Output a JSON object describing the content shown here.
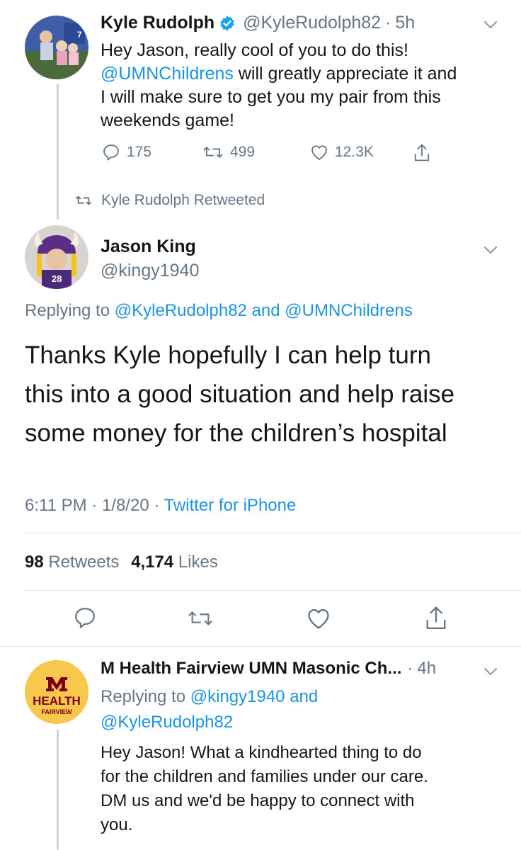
{
  "colors": {
    "accent": "#1b95e0",
    "muted": "#657786",
    "text": "#14171a",
    "divider": "#e1e8ed",
    "verified": "#1da1f2"
  },
  "tweet1": {
    "name": "Kyle Rudolph",
    "handle": "@KyleRudolph82",
    "dot": "·",
    "time": "5h",
    "text_line1": "Hey Jason, really cool of you to do this!",
    "mention": "@UMNChildrens",
    "text_line2_rest": " will greatly appreciate it and",
    "text_line3": "I will make sure to get you my pair from this",
    "text_line4": "weekends game!",
    "replies": "175",
    "retweets": "499",
    "likes": "12.3K",
    "avatar_badge": "7"
  },
  "retweeted_banner": {
    "label": "Kyle Rudolph Retweeted"
  },
  "main_tweet": {
    "name": "Jason King",
    "handle": "@kingy1940",
    "replying_prefix": "Replying to ",
    "replying_user1": "@KyleRudolph82",
    "replying_and": " and ",
    "replying_user2": "@UMNChildrens",
    "text_line1": "Thanks Kyle hopefully I can help turn",
    "text_line2": "this into a good situation and help raise",
    "text_line3": "some money for the children’s hospital",
    "time": "6:11 PM",
    "sep1": " · ",
    "date": "1/8/20",
    "sep2": " · ",
    "source": "Twitter for iPhone",
    "retweet_count": "98",
    "retweet_label": "Retweets",
    "like_count": "4,174",
    "like_label": "Likes",
    "jersey_number": "28"
  },
  "reply_tweet": {
    "name": "M Health Fairview UMN Masonic Ch...",
    "dot": "·",
    "time": "4h",
    "replying_prefix": "Replying to ",
    "replying_user1": "@kingy1940",
    "replying_and": " and",
    "replying_user2": "@KyleRudolph82",
    "text_line1": "Hey Jason! What a kindhearted thing to do",
    "text_line2": "for the children and families under our care.",
    "text_line3": "DM us and we'd be happy to connect with",
    "text_line4": "you.",
    "logo_line1": "HEALTH",
    "logo_line2": "FAIRVIEW"
  }
}
